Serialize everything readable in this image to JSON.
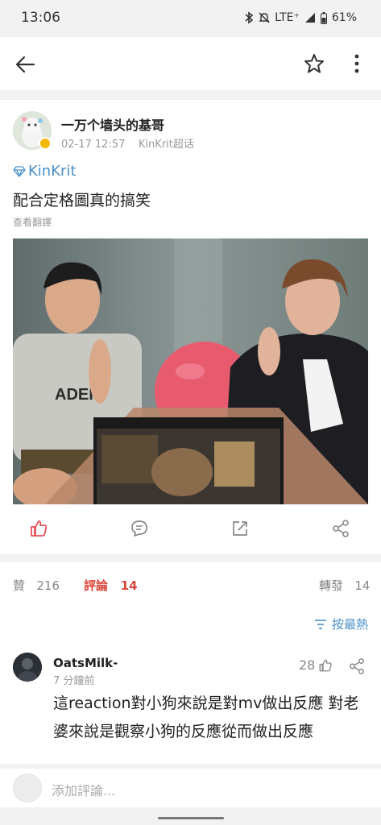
{
  "status_bar": {
    "time": "13:06",
    "network": "LTE⁺",
    "battery": "61%",
    "icons": [
      "bluetooth-icon",
      "mute-icon",
      "signal-icon",
      "battery-icon"
    ]
  },
  "top_bar": {
    "icons": [
      "back-arrow-icon",
      "star-icon",
      "more-vertical-icon"
    ]
  },
  "post": {
    "author": "一万个墙头的基哥",
    "date": "02-17 12:57",
    "source": "KinKrit超话",
    "topic": "KinKrit",
    "text": "配合定格圖真的搞笑",
    "translate_label": "查看翻譯",
    "photo_description": "photo",
    "actions": [
      "like-icon",
      "comment-icon",
      "repost-icon",
      "share-icon"
    ]
  },
  "stats": {
    "likes_label": "贊",
    "likes_count": "216",
    "comments_label": "評論",
    "comments_count": "14",
    "reposts_label": "轉發",
    "reposts_count": "14",
    "sort_label": "按最熱"
  },
  "comment": {
    "username": "OatsMilk-",
    "time": "7 分鐘前",
    "likes": "28",
    "text": "這reaction對小狗來說是對mv做出反應 對老婆來說是觀察小狗的反應從而做出反應"
  },
  "add_comment": {
    "placeholder": "添加評論..."
  },
  "colors": {
    "accent_blue": "#4a90c8",
    "accent_red": "#d9463b",
    "like_active": "#e8505b"
  }
}
